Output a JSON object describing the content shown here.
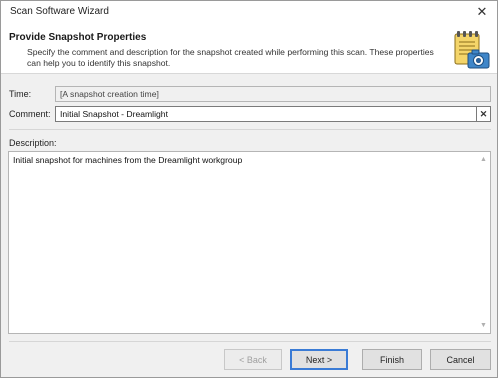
{
  "window": {
    "title": "Scan Software Wizard",
    "close_glyph": "✕"
  },
  "header": {
    "title": "Provide Snapshot Properties",
    "description": "Specify the comment and description for the snapshot created while performing this scan. These properties can help you to identify this snapshot.",
    "icon": "notepad-camera-icon"
  },
  "form": {
    "time_label": "Time:",
    "time_value": "[A snapshot creation time]",
    "comment_label": "Comment:",
    "comment_value": "Initial Snapshot - Dreamlight",
    "clear_glyph": "✕",
    "description_label": "Description:",
    "description_value": "Initial snapshot for machines from the Dreamlight workgroup"
  },
  "buttons": {
    "back": "< Back",
    "next": "Next >",
    "finish": "Finish",
    "cancel": "Cancel"
  },
  "colors": {
    "accent": "#3a7bd5"
  }
}
